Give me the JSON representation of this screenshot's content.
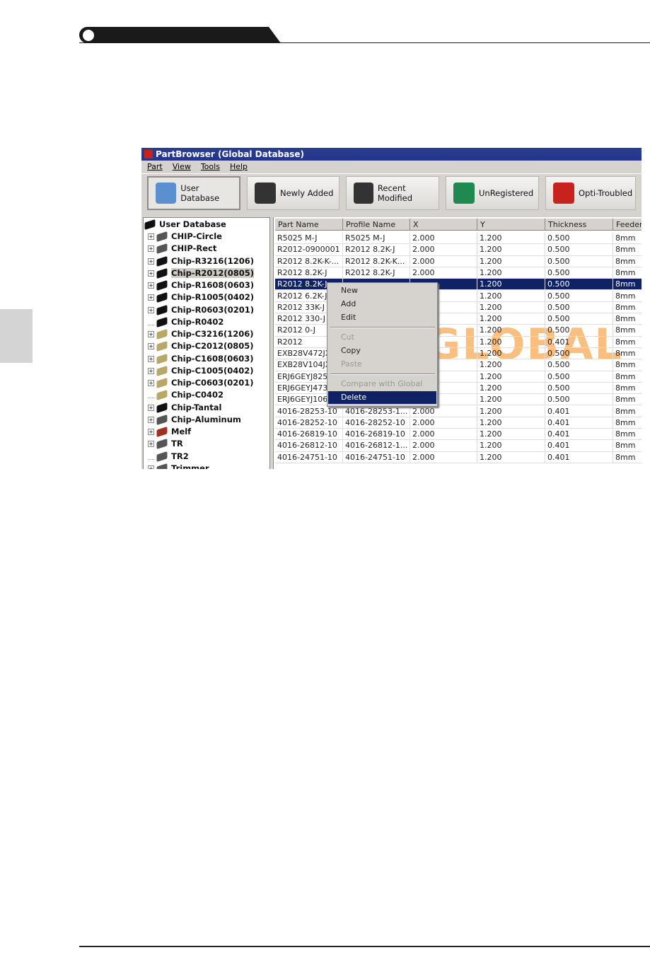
{
  "app": {
    "title": "PartBrowser (Global Database)",
    "menu": [
      "Part",
      "View",
      "Tools",
      "Help"
    ],
    "toolbar": [
      {
        "label": "User Database",
        "icon": "user-database-icon",
        "color": "#5a8fd0"
      },
      {
        "label": "Newly Added",
        "icon": "chip-plus-icon",
        "color": "#333"
      },
      {
        "label": "Recent Modified",
        "icon": "chip-wrench-icon",
        "color": "#333"
      },
      {
        "label": "UnRegistered",
        "icon": "green-diamond-question-icon",
        "color": "#1e8a50"
      },
      {
        "label": "Opti-Troubled",
        "icon": "nozzle-error-icon",
        "color": "#c8221c"
      }
    ]
  },
  "tree": {
    "root": "User Database",
    "selected": "Chip-R2012(0805)",
    "items": [
      "CHIP-Circle",
      "CHIP-Rect",
      "Chip-R3216(1206)",
      "Chip-R2012(0805)",
      "Chip-R1608(0603)",
      "Chip-R1005(0402)",
      "Chip-R0603(0201)",
      "Chip-R0402",
      "Chip-C3216(1206)",
      "Chip-C2012(0805)",
      "Chip-C1608(0603)",
      "Chip-C1005(0402)",
      "Chip-C0603(0201)",
      "Chip-C0402",
      "Chip-Tantal",
      "Chip-Aluminum",
      "Melf",
      "TR",
      "TR2",
      "Trimmer"
    ]
  },
  "grid": {
    "columns": [
      "Part Name",
      "Profile Name",
      "X",
      "Y",
      "Thickness",
      "Feeder"
    ],
    "rows": [
      [
        "R5025 M-J",
        "R5025 M-J",
        "2.000",
        "1.200",
        "0.500",
        "8mm"
      ],
      [
        "R2012-0900001",
        "R2012 8.2K-J",
        "2.000",
        "1.200",
        "0.500",
        "8mm"
      ],
      [
        "R2012 8.2K-K-...",
        "R2012 8.2K-K...",
        "2.000",
        "1.200",
        "0.500",
        "8mm"
      ],
      [
        "R2012 8.2K-J",
        "R2012 8.2K-J",
        "2.000",
        "1.200",
        "0.500",
        "8mm"
      ],
      [
        "R2012 8.2K-J",
        "",
        "",
        "1.200",
        "0.500",
        "8mm"
      ],
      [
        "R2012 6.2K-J",
        "",
        "",
        "1.200",
        "0.500",
        "8mm"
      ],
      [
        "R2012 33K-J",
        "",
        "",
        "1.200",
        "0.500",
        "8mm"
      ],
      [
        "R2012 330-J",
        "",
        "",
        "1.200",
        "0.500",
        "8mm"
      ],
      [
        "R2012 0-J",
        "",
        "",
        "1.200",
        "0.500",
        "8mm"
      ],
      [
        "R2012",
        "",
        "",
        "1.200",
        "0.401",
        "8mm"
      ],
      [
        "EXB28V472JX",
        "",
        "",
        "1.200",
        "0.500",
        "8mm"
      ],
      [
        "EXB28V104JX",
        "",
        "",
        "1.200",
        "0.500",
        "8mm"
      ],
      [
        "ERJ6GEYJ825",
        "",
        "",
        "1.200",
        "0.500",
        "8mm"
      ],
      [
        "ERJ6GEYJ473",
        "",
        "",
        "1.200",
        "0.500",
        "8mm"
      ],
      [
        "ERJ6GEYJ106",
        "",
        "",
        "1.200",
        "0.500",
        "8mm"
      ],
      [
        "4016-28253-10",
        "4016-28253-1...",
        "2.000",
        "1.200",
        "0.401",
        "8mm"
      ],
      [
        "4016-28252-10",
        "4016-28252-10",
        "2.000",
        "1.200",
        "0.401",
        "8mm"
      ],
      [
        "4016-26819-10",
        "4016-26819-10",
        "2.000",
        "1.200",
        "0.401",
        "8mm"
      ],
      [
        "4016-26812-10",
        "4016-26812-1...",
        "2.000",
        "1.200",
        "0.401",
        "8mm"
      ],
      [
        "4016-24751-10",
        "4016-24751-10",
        "2.000",
        "1.200",
        "0.401",
        "8mm"
      ]
    ],
    "selected_row": 4,
    "watermark": "GLOBAL DAT"
  },
  "context_menu": {
    "items": [
      {
        "label": "New",
        "enabled": true
      },
      {
        "label": "Add",
        "enabled": true
      },
      {
        "label": "Edit",
        "enabled": true
      },
      {
        "label": "Cut",
        "enabled": false
      },
      {
        "label": "Copy",
        "enabled": true
      },
      {
        "label": "Paste",
        "enabled": false
      },
      {
        "label": "Compare with Global",
        "enabled": false
      },
      {
        "label": "Delete",
        "enabled": true,
        "highlighted": true
      }
    ]
  }
}
